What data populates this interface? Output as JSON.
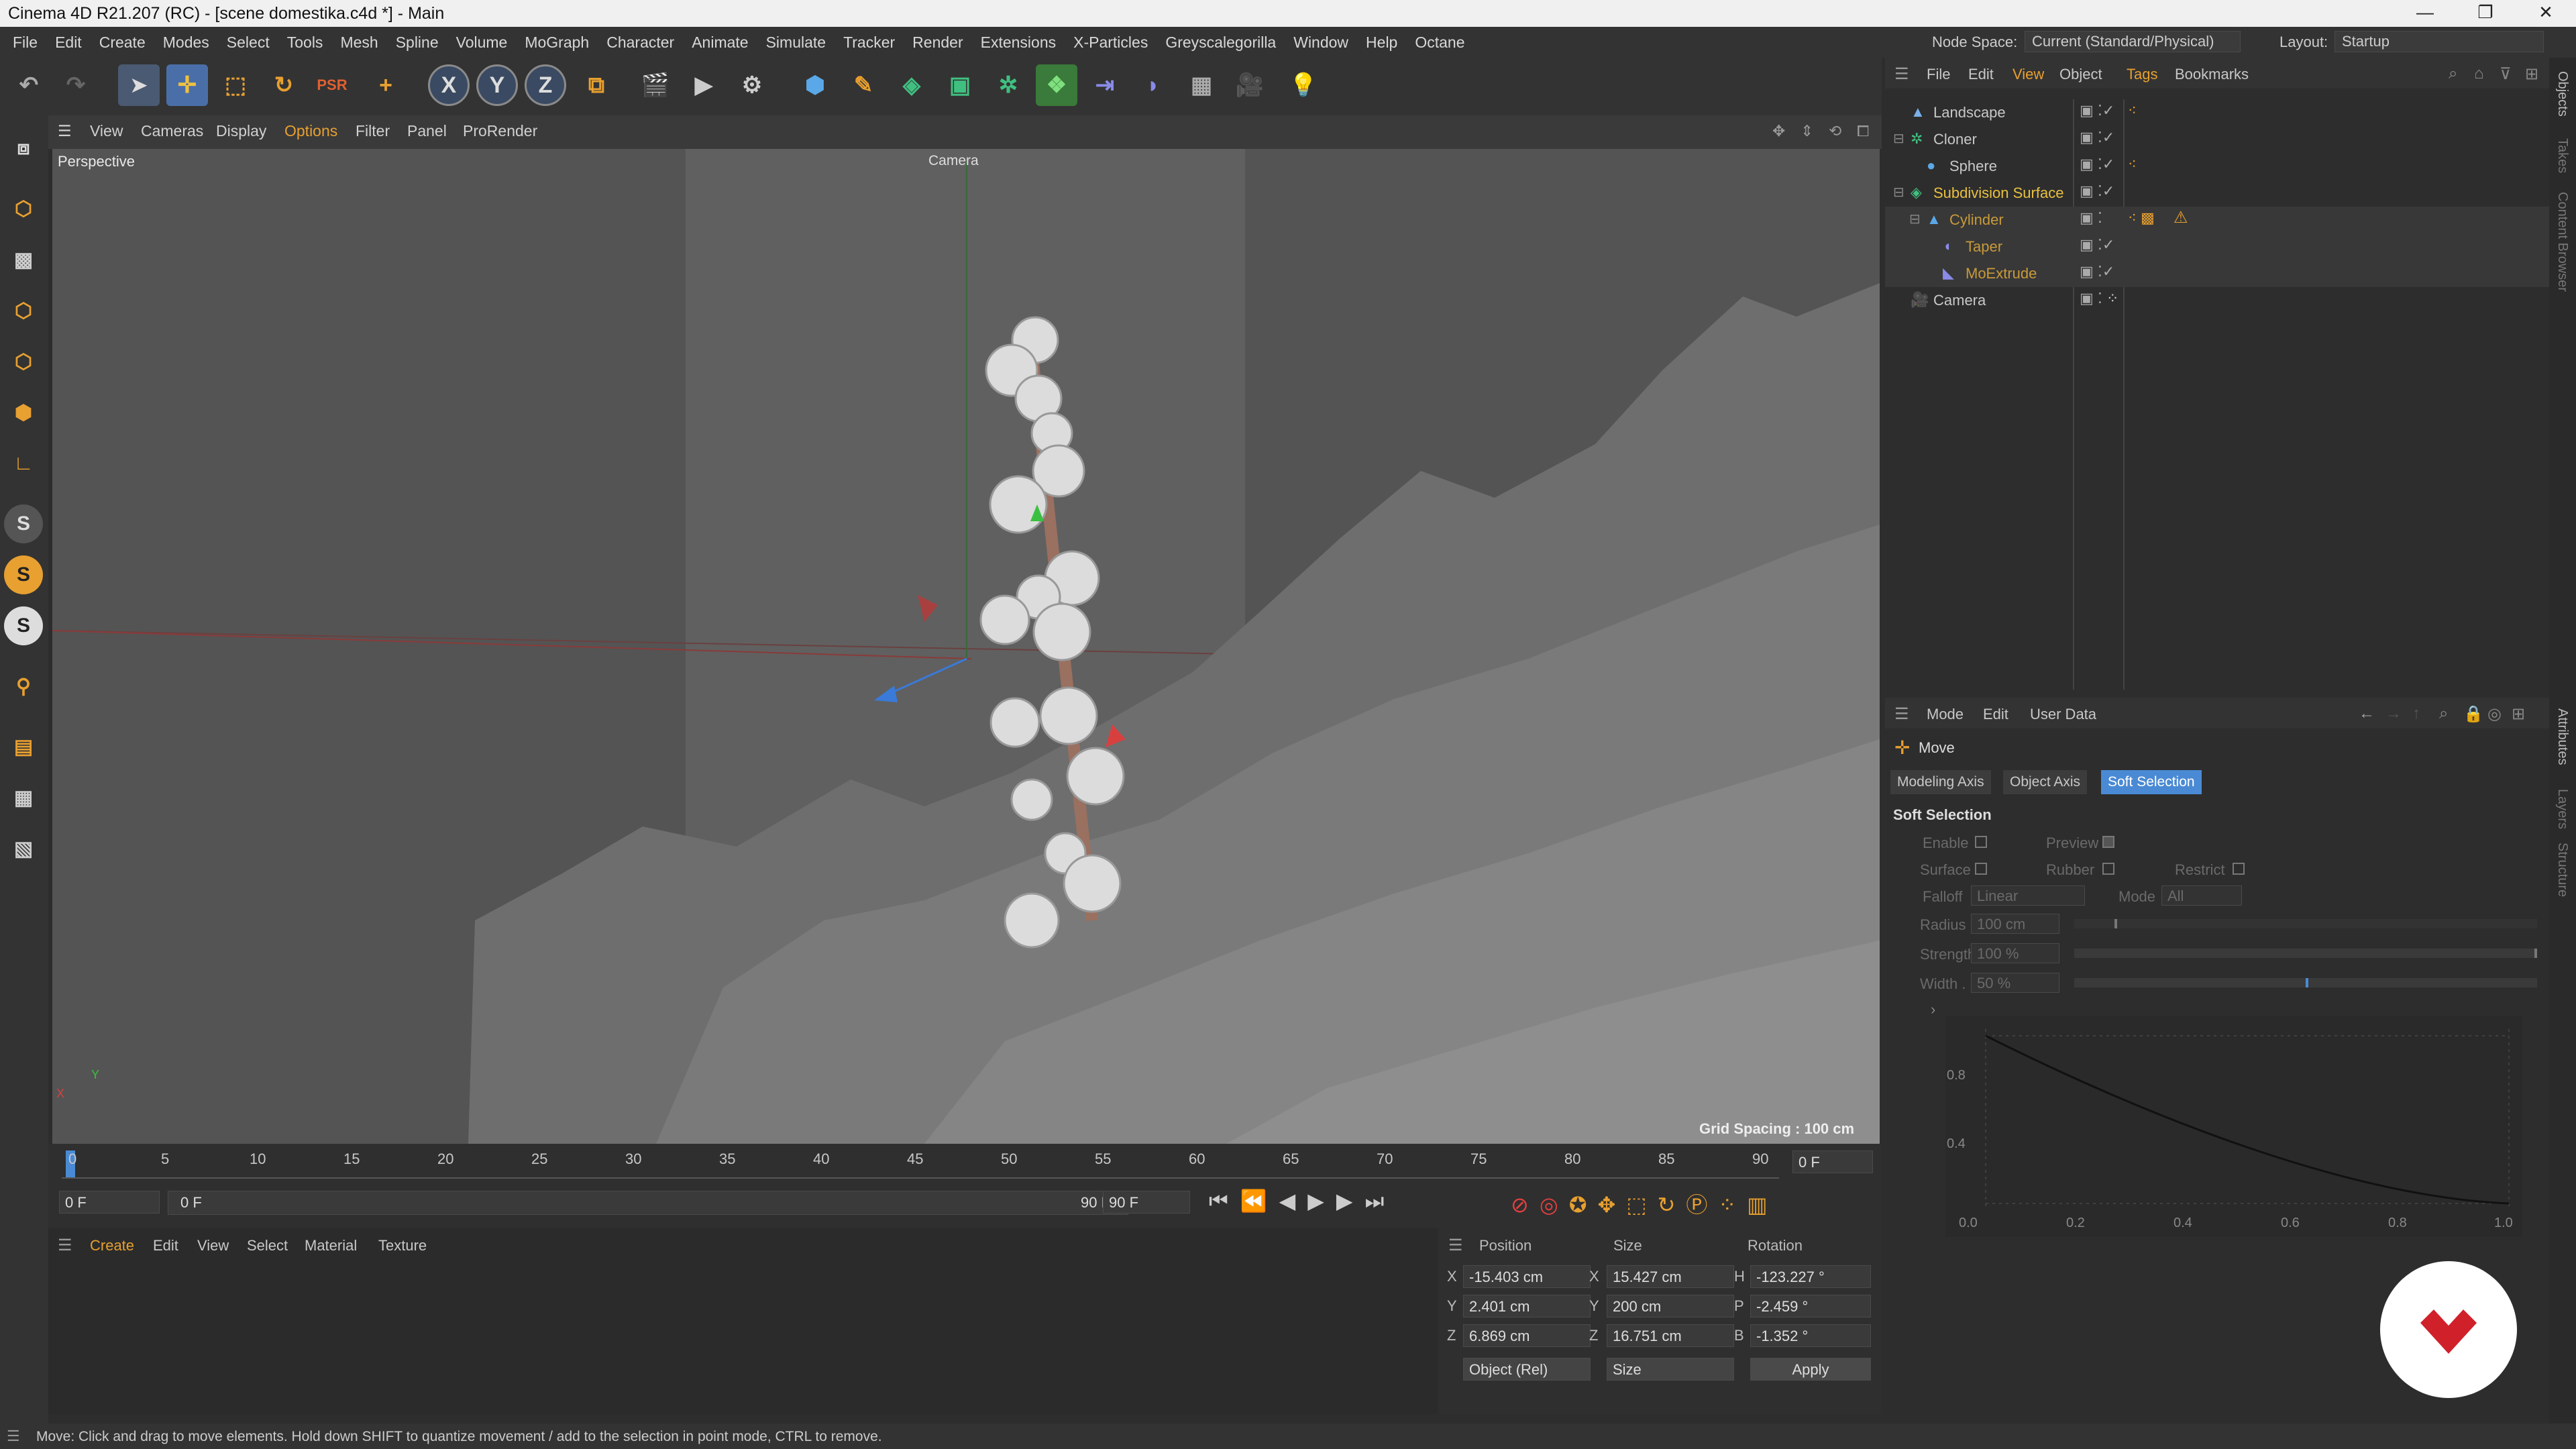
{
  "window": {
    "title": "Cinema 4D R21.207 (RC) - [scene domestika.c4d *] - Main",
    "minimize": "—",
    "maximize": "❐",
    "close": "✕"
  },
  "menu": [
    "File",
    "Edit",
    "Create",
    "Modes",
    "Select",
    "Tools",
    "Mesh",
    "Spline",
    "Volume",
    "MoGraph",
    "Character",
    "Animate",
    "Simulate",
    "Tracker",
    "Render",
    "Extensions",
    "X-Particles",
    "Greyscalegorilla",
    "Window",
    "Help",
    "Octane"
  ],
  "nodespace": {
    "label": "Node Space:",
    "value": "Current (Standard/Physical)"
  },
  "layout": {
    "label": "Layout:",
    "value": "Startup"
  },
  "toolbar": {
    "axis_x": "X",
    "axis_y": "Y",
    "axis_z": "Z"
  },
  "left_toolbar": {
    "s1": "S",
    "s2": "S",
    "s3": "S"
  },
  "viewport": {
    "menu": [
      "View",
      "Cameras",
      "Display",
      "Options",
      "Filter",
      "Panel",
      "ProRender"
    ],
    "name": "Perspective",
    "camera_label": "Camera",
    "grid_spacing": "Grid Spacing : 100 cm",
    "axis_x": "X",
    "axis_y": "Y"
  },
  "timeline": {
    "ticks": [
      "0",
      "5",
      "10",
      "15",
      "20",
      "25",
      "30",
      "35",
      "40",
      "45",
      "50",
      "55",
      "60",
      "65",
      "70",
      "75",
      "80",
      "85",
      "90"
    ],
    "current_frame": "0 F",
    "start": "0 F",
    "range_start": "0 F",
    "range_end": "90 F",
    "end": "90 F",
    "frame_display": "0 F"
  },
  "material_manager": {
    "menu": [
      "Create",
      "Edit",
      "View",
      "Select",
      "Material",
      "Texture"
    ]
  },
  "coordinates": {
    "headers": {
      "position": "Position",
      "size": "Size",
      "rotation": "Rotation"
    },
    "rows": [
      {
        "axis": "X",
        "pos": "-15.403 cm",
        "size_axis": "X",
        "size": "15.427 cm",
        "rot_axis": "H",
        "rot": "-123.227 °"
      },
      {
        "axis": "Y",
        "pos": "2.401 cm",
        "size_axis": "Y",
        "size": "200 cm",
        "rot_axis": "P",
        "rot": "-2.459 °"
      },
      {
        "axis": "Z",
        "pos": "6.869 cm",
        "size_axis": "Z",
        "size": "16.751 cm",
        "rot_axis": "B",
        "rot": "-1.352 °"
      }
    ],
    "mode": "Object (Rel)",
    "size_mode": "Size",
    "apply": "Apply"
  },
  "status": "Move: Click and drag to move elements. Hold down SHIFT to quantize movement / add to the selection in point mode, CTRL to remove.",
  "object_manager": {
    "menu": [
      "File",
      "Edit",
      "View",
      "Object",
      "Tags",
      "Bookmarks"
    ],
    "objects": [
      {
        "name": "Landscape",
        "color": "#cfcfcf"
      },
      {
        "name": "Cloner",
        "color": "#cfcfcf"
      },
      {
        "name": "Sphere",
        "color": "#cfcfcf"
      },
      {
        "name": "Subdivision Surface",
        "color": "#e8c040"
      },
      {
        "name": "Cylinder",
        "color": "#c89a3a"
      },
      {
        "name": "Taper",
        "color": "#c89a3a"
      },
      {
        "name": "MoExtrude",
        "color": "#c89a3a"
      },
      {
        "name": "Camera",
        "color": "#cfcfcf"
      }
    ]
  },
  "attribute_manager": {
    "menu": [
      "Mode",
      "Edit",
      "User Data"
    ],
    "tool": "Move",
    "tabs": [
      "Modeling Axis",
      "Object Axis",
      "Soft Selection"
    ],
    "section": "Soft Selection",
    "enable": "Enable",
    "preview": "Preview",
    "surface": "Surface",
    "rubber": "Rubber",
    "restrict": "Restrict",
    "falloff": "Falloff",
    "falloff_value": "Linear",
    "mode": "Mode",
    "mode_value": "All",
    "radius": "Radius",
    "radius_value": "100 cm",
    "strength": "Strength",
    "strength_value": "100 %",
    "width": "Width . .",
    "width_value": "50 %",
    "graph_y_ticks": [
      "0.8",
      "0.4"
    ],
    "graph_x_ticks": [
      "0.0",
      "0.2",
      "0.4",
      "0.6",
      "0.8",
      "1.0"
    ]
  },
  "side_tabs": [
    "Objects",
    "Takes",
    "Content Browser",
    "Attributes",
    "Layers",
    "Structure"
  ],
  "accent": "#4a8ad4",
  "badge_color": "#d0202a"
}
